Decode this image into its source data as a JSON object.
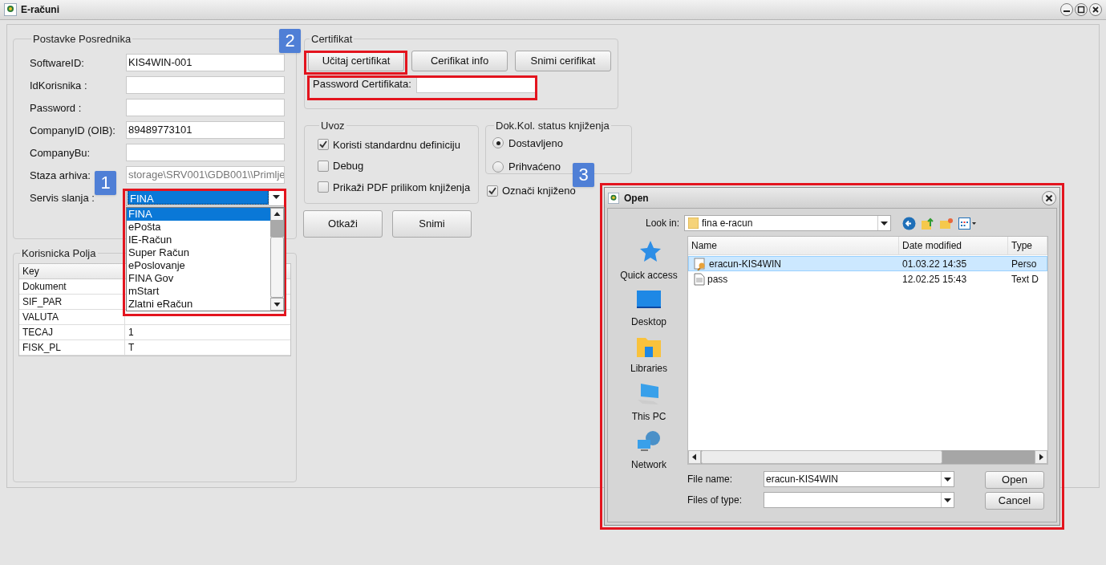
{
  "window": {
    "title": "E-računi"
  },
  "broker_settings": {
    "title": "Postavke Posrednika",
    "fields": [
      {
        "label": "SoftwareID:",
        "value": "KIS4WIN-001",
        "kind": "text"
      },
      {
        "label": "IdKorisnika :",
        "kind": "text"
      },
      {
        "label": "Password :",
        "kind": "text"
      },
      {
        "label": "CompanyID (OIB):",
        "value": "89489773101",
        "kind": "text"
      },
      {
        "label": "CompanyBu:",
        "kind": "text"
      },
      {
        "label": "Staza arhiva:",
        "value": "storage\\SRV001\\GDB001\\\\Primlje",
        "kind": "readonly"
      },
      {
        "label": "Servis slanja :",
        "value": "FINA",
        "kind": "combo"
      }
    ]
  },
  "service_list": {
    "items": [
      {
        "label": "FINA",
        "selected": true
      },
      {
        "label": "ePošta",
        "selected": false
      },
      {
        "label": "IE-Račun",
        "selected": false
      },
      {
        "label": "Super Račun",
        "selected": false
      },
      {
        "label": "ePoslovanje",
        "selected": false
      },
      {
        "label": "FINA Gov",
        "selected": false
      },
      {
        "label": "mStart",
        "selected": false
      },
      {
        "label": "Zlatni eRačun",
        "selected": false
      }
    ]
  },
  "user_fields": {
    "title": "Korisnicka Polja",
    "columns": [
      "Key"
    ],
    "rows": [
      {
        "key": "Dokument"
      },
      {
        "key": "SIF_PAR"
      },
      {
        "key": "VALUTA"
      },
      {
        "key": "TECAJ",
        "value": "1"
      },
      {
        "key": "FISK_PL",
        "value": "T"
      }
    ]
  },
  "certificate": {
    "title": "Certifikat",
    "buttons": [
      "Učitaj certifikat",
      "Cerifikat info",
      "Snimi cerifikat"
    ],
    "password_label": "Password Certifikata:"
  },
  "import": {
    "title": "Uvoz",
    "options": [
      {
        "label": "Koristi standardnu definiciju",
        "checked": true
      },
      {
        "label": "Debug",
        "checked": false
      },
      {
        "label": "Prikaži PDF prilikom knjiženja",
        "checked": false
      }
    ]
  },
  "booking_status": {
    "title": "Dok.Kol. status knjiženja",
    "options": [
      {
        "label": "Dostavljeno",
        "selected": true
      },
      {
        "label": "Prihvaćeno",
        "selected": false
      }
    ]
  },
  "mark_booked": {
    "label": "Označi knjiženo",
    "checked": true
  },
  "actions": [
    "Otkaži",
    "Snimi"
  ],
  "open_dialog": {
    "title": "Open",
    "look_in_label": "Look in:",
    "look_in_value": "fina e-racun",
    "places": [
      {
        "label": "Quick access",
        "kind": "star"
      },
      {
        "label": "Desktop",
        "kind": "desktop"
      },
      {
        "label": "Libraries",
        "kind": "library"
      },
      {
        "label": "This PC",
        "kind": "pc"
      },
      {
        "label": "Network",
        "kind": "network"
      }
    ],
    "columns": [
      "Name",
      "Date modified",
      "Type"
    ],
    "files": [
      {
        "name": "eracun-KIS4WIN",
        "date": "01.03.22 14:35",
        "type": "Perso",
        "kind": "certificate",
        "selected": true
      },
      {
        "name": "pass",
        "date": "12.02.25 15:43",
        "type": "Text D",
        "kind": "text",
        "selected": false
      }
    ],
    "file_name_label": "File name:",
    "file_name_value": "eracun-KIS4WIN",
    "file_type_label": "Files of type:",
    "buttons": [
      "Open",
      "Cancel"
    ]
  },
  "annotations": [
    {
      "label": "1"
    },
    {
      "label": "2"
    },
    {
      "label": "3"
    }
  ]
}
